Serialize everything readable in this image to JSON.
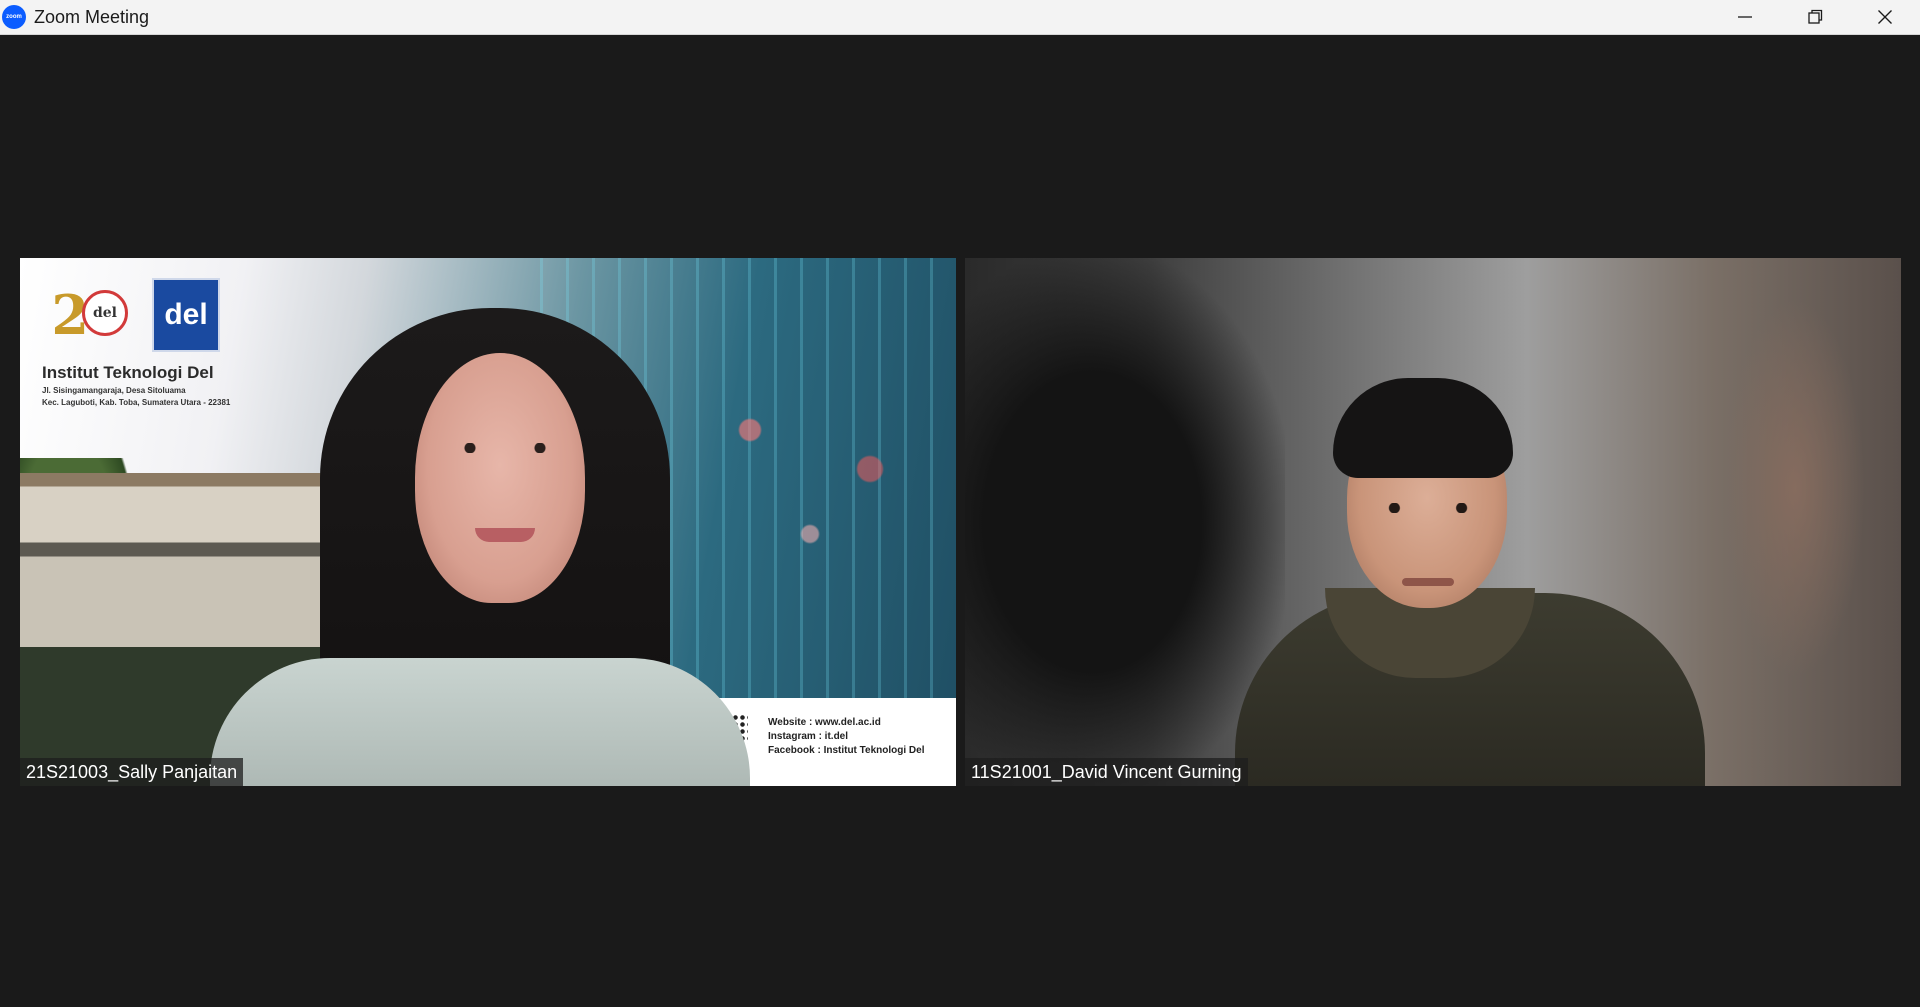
{
  "window": {
    "title": "Zoom Meeting",
    "app_icon": "zoom-icon",
    "controls": [
      "minimize-icon",
      "restore-icon",
      "close-icon"
    ]
  },
  "participants": [
    {
      "name": "21S21003_Sally Panjaitan",
      "background": {
        "logo_text": "del",
        "logo_year": "20",
        "institution": "Institut Teknologi Del",
        "address_line1": "Jl. Sisingamangaraja, Desa Sitoluama",
        "address_line2": "Kec. Laguboti, Kab. Toba, Sumatera Utara - 22381",
        "website": "Website    : www.del.ac.id",
        "instagram": "Instagram : it.del",
        "facebook": "Facebook : Institut Teknologi Del"
      }
    },
    {
      "name": "11S21001_David Vincent Gurning"
    }
  ],
  "colors": {
    "stage_bg": "#1a1a1a",
    "titlebar_bg": "#f3f3f3",
    "zoom_blue": "#0b5cff"
  }
}
